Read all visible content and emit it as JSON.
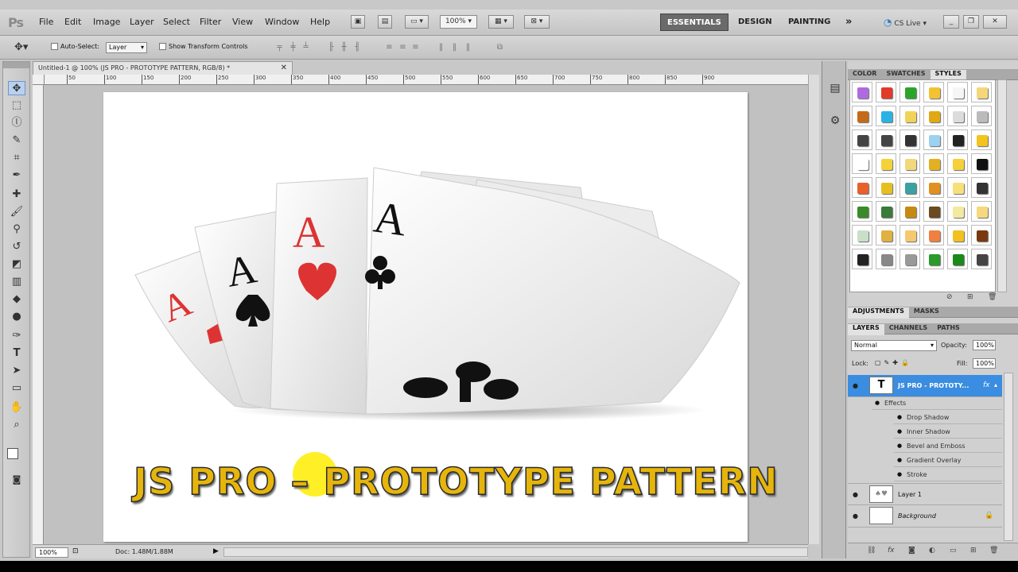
{
  "app": {
    "logo": "Ps"
  },
  "menu": [
    "File",
    "Edit",
    "Image",
    "Layer",
    "Select",
    "Filter",
    "View",
    "Window",
    "Help"
  ],
  "menubar_extras": {
    "zoom": "100%"
  },
  "workspaces": {
    "essentials": "ESSENTIALS",
    "design": "DESIGN",
    "painting": "PAINTING",
    "more": "»",
    "cslive": "CS Live ▾"
  },
  "options": {
    "auto_select_label": "Auto-Select:",
    "auto_select_value": "Layer",
    "show_transform": "Show Transform Controls"
  },
  "document": {
    "tab_title": "Untitled-1 @ 100% (JS PRO - PROTOTYPE PATTERN, RGB/8) *",
    "ruler_marks": [
      "50",
      "100",
      "150",
      "200",
      "250",
      "300",
      "350",
      "400",
      "450",
      "500",
      "550",
      "600",
      "650",
      "700",
      "750",
      "800",
      "850",
      "900"
    ],
    "poster_title": "JS PRO – PROTOTYPE PATTERN",
    "card_letter": "A"
  },
  "status": {
    "zoom": "100%",
    "doc_size": "Doc: 1.48M/1.88M"
  },
  "panels": {
    "top_tabs": [
      "COLOR",
      "SWATCHES",
      "STYLES"
    ],
    "adjust_tabs": [
      "ADJUSTMENTS",
      "MASKS"
    ],
    "layer_tabs": [
      "LAYERS",
      "CHANNELS",
      "PATHS"
    ],
    "blend_mode": "Normal",
    "opacity_label": "Opacity:",
    "opacity_value": "100%",
    "lock_label": "Lock:",
    "fill_label": "Fill:",
    "fill_value": "100%"
  },
  "layers": {
    "text_layer": "JS PRO - PROTOTY...",
    "effects_label": "Effects",
    "effects": [
      "Drop Shadow",
      "Inner Shadow",
      "Bevel and Emboss",
      "Gradient Overlay",
      "Stroke"
    ],
    "layer1": "Layer 1",
    "background": "Background"
  },
  "colors": {
    "accent": "#3a8de0",
    "title_fill": "#e6b50c"
  }
}
